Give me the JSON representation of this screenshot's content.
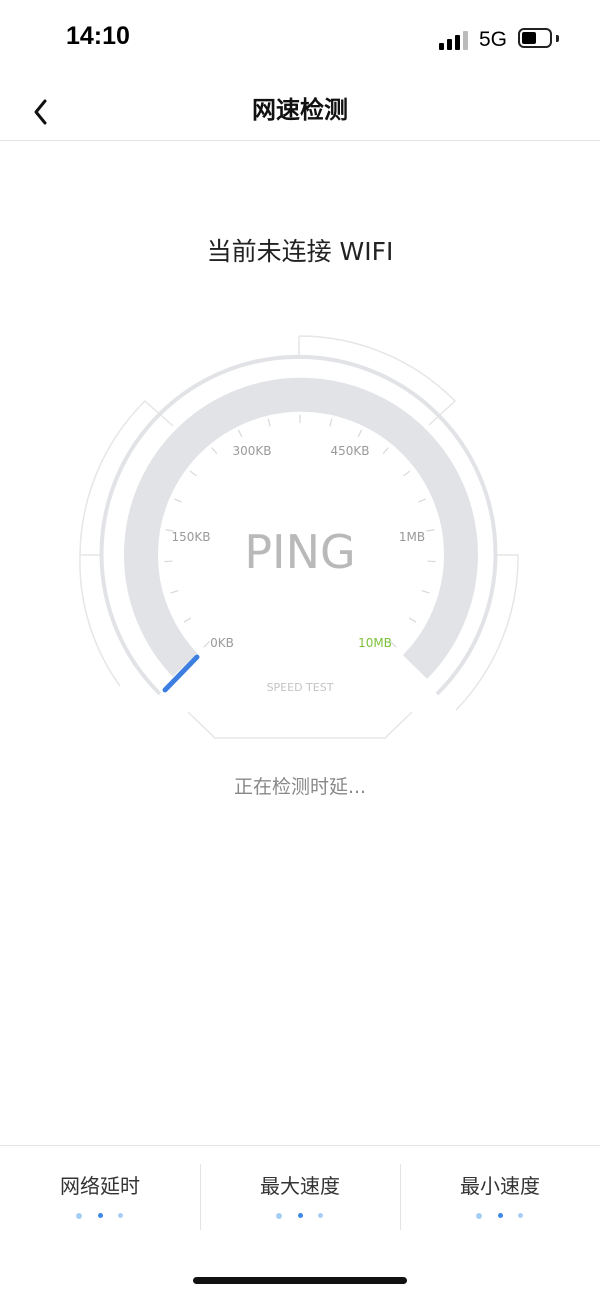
{
  "status_bar": {
    "time": "14:10",
    "network": "5G",
    "signal_bars": 4,
    "battery_level": 0.45
  },
  "nav": {
    "back_icon": "chevron-left-icon",
    "title": "网速检测"
  },
  "wifi_status": "当前未连接 WIFI",
  "gauge": {
    "center_label": "PING",
    "bottom_label": "SPEED TEST",
    "scale_labels": [
      "0KB",
      "150KB",
      "300KB",
      "450KB",
      "1MB",
      "10MB"
    ],
    "current_value_fraction": 0.0,
    "colors": {
      "needle": "#3d7fe0",
      "highlight_label": "#7cc23a",
      "track": "#e1e3e6"
    }
  },
  "detect_status": "正在检测时延...",
  "metrics": [
    {
      "label": "网络延时"
    },
    {
      "label": "最大速度"
    },
    {
      "label": "最小速度"
    }
  ],
  "colors": {
    "dot_light": "#a6cff5",
    "dot_dark": "#3d8ae6"
  }
}
